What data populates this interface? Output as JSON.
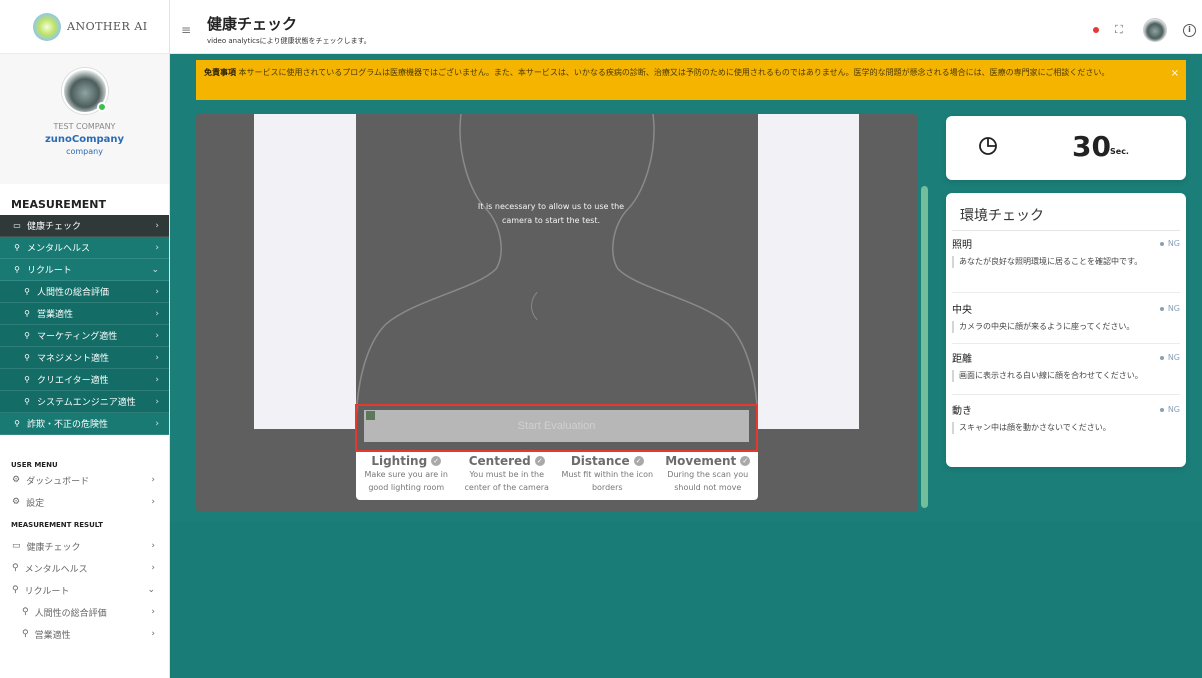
{
  "brand": {
    "name": "ANOTHER AI"
  },
  "profile": {
    "company_label": "TEST COMPANY",
    "company_name": "zunoCompany",
    "company_sub": "company"
  },
  "sidebar": {
    "section_title": "MEASUREMENT",
    "items": [
      {
        "label": "健康チェック",
        "icon": "monitor-icon",
        "chev": "›"
      },
      {
        "label": "メンタルヘルス",
        "icon": "pin-icon",
        "chev": "›"
      },
      {
        "label": "リクルート",
        "icon": "pin-icon",
        "chev": "⌄"
      },
      {
        "label": "人間性の総合評価",
        "icon": "pin-icon",
        "chev": "›"
      },
      {
        "label": "営業適性",
        "icon": "pin-icon",
        "chev": "›"
      },
      {
        "label": "マーケティング適性",
        "icon": "pin-icon",
        "chev": "›"
      },
      {
        "label": "マネジメント適性",
        "icon": "pin-icon",
        "chev": "›"
      },
      {
        "label": "クリエイター適性",
        "icon": "pin-icon",
        "chev": "›"
      },
      {
        "label": "システムエンジニア適性",
        "icon": "pin-icon",
        "chev": "›"
      },
      {
        "label": "詐欺・不正の危険性",
        "icon": "pin-icon",
        "chev": "›"
      }
    ],
    "user_menu_title": "USER MENU",
    "user_menu": [
      {
        "label": "ダッシュボード",
        "icon": "dashboard-icon",
        "chev": "›"
      },
      {
        "label": "設定",
        "icon": "gear-icon",
        "chev": "›"
      }
    ],
    "result_title": "MEASUREMENT RESULT",
    "results": [
      {
        "label": "健康チェック",
        "icon": "monitor-icon",
        "chev": "›"
      },
      {
        "label": "メンタルヘルス",
        "icon": "pin-icon",
        "chev": "›"
      },
      {
        "label": "リクルート",
        "icon": "pin-icon",
        "chev": "⌄"
      },
      {
        "label": "人間性の総合評価",
        "icon": "pin-icon",
        "chev": "›"
      },
      {
        "label": "営業適性",
        "icon": "pin-icon",
        "chev": "›"
      }
    ]
  },
  "header": {
    "title": "健康チェック",
    "subtitle": "video analyticsにより健康状態をチェックします。"
  },
  "disclaimer": {
    "label": "免責事項",
    "text": " 本サービスに使用されているプログラムは医療機器ではございません。また、本サービスは、いかなる疾病の診断、治療又は予防のために使用されるものではありません。医学的な問題が懸念される場合には、医療の専門家にご相談ください。",
    "close": "×"
  },
  "camera": {
    "message": "It is necessary to allow us to use the camera to start the test.",
    "button": "Start Evaluation",
    "criteria": [
      {
        "title": "Lighting",
        "desc": "Make sure you are in good lighting room"
      },
      {
        "title": "Centered",
        "desc": "You must be in the center of the camera"
      },
      {
        "title": "Distance",
        "desc": "Must fit within the icon borders"
      },
      {
        "title": "Movement",
        "desc": "During the scan you should not move"
      }
    ]
  },
  "timer": {
    "value": "30",
    "unit": "Sec."
  },
  "env": {
    "title": "環境チェック",
    "items": [
      {
        "name": "照明",
        "status": "NG",
        "desc": "あなたが良好な照明環境に居ることを確認中です。"
      },
      {
        "name": "中央",
        "status": "NG",
        "desc": "カメラの中央に顔が来るように座ってください。"
      },
      {
        "name": "距離",
        "status": "NG",
        "desc": "画面に表示される白い線に顔を合わせてください。"
      },
      {
        "name": "動き",
        "status": "NG",
        "desc": "スキャン中は顔を動かさないでください。"
      }
    ]
  },
  "colors": {
    "teal": "#197a74",
    "active": "#2f3a38",
    "warning": "#f5b400",
    "highlight": "#e5392d"
  }
}
